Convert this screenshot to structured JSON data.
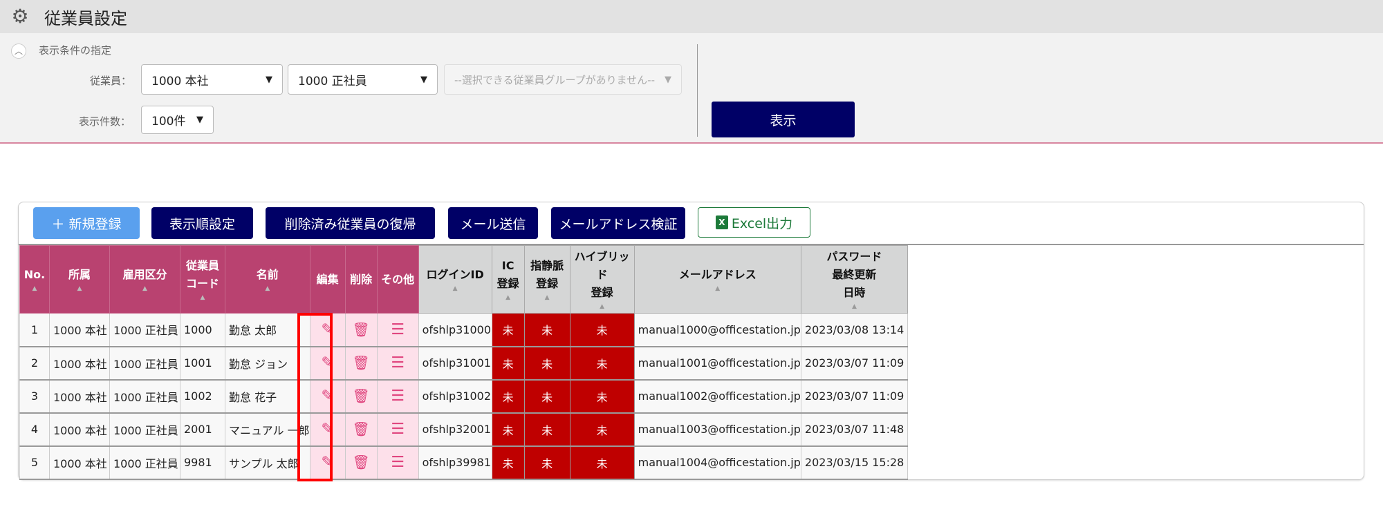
{
  "header": {
    "title": "従業員設定",
    "icon": "gear-icon"
  },
  "filter": {
    "section_label": "表示条件の指定",
    "employee_label": "従業員：",
    "office_select": "1000 本社",
    "employment_select": "1000 正社員",
    "group_select": "--選択できる従業員グループがありません--",
    "count_label": "表示件数：",
    "count_select": "100件",
    "show_button": "表示"
  },
  "toolbar": {
    "new": "＋ 新規登録",
    "order": "表示順設定",
    "restore": "削除済み従業員の復帰",
    "mail": "メール送信",
    "verify": "メールアドレス検証",
    "excel": "Excel出力"
  },
  "table": {
    "columns": [
      {
        "label": "No.",
        "style": "p",
        "sort": true
      },
      {
        "label": "所属",
        "style": "p",
        "sort": true
      },
      {
        "label": "雇用区分",
        "style": "p",
        "sort": true
      },
      {
        "label": "従業員\nコード",
        "style": "p",
        "sort": true
      },
      {
        "label": "名前",
        "style": "p",
        "sort": true
      },
      {
        "label": "編集",
        "style": "p",
        "sort": false
      },
      {
        "label": "削除",
        "style": "p",
        "sort": false
      },
      {
        "label": "その他",
        "style": "p",
        "sort": false
      },
      {
        "label": "ログインID",
        "style": "g",
        "sort": true
      },
      {
        "label": "IC\n登録",
        "style": "g",
        "sort": true
      },
      {
        "label": "指静脈\n登録",
        "style": "g",
        "sort": true
      },
      {
        "label": "ハイブリッド\n登録",
        "style": "g",
        "sort": true
      },
      {
        "label": "メールアドレス",
        "style": "g",
        "sort": true
      },
      {
        "label": "パスワード\n最終更新\n日時",
        "style": "g",
        "sort": true
      }
    ],
    "rows": [
      {
        "no": "1",
        "office": "1000 本社",
        "type": "1000 正社員",
        "code": "1000",
        "name": "勤怠 太郎",
        "login": "ofshlp31000",
        "ic": "未",
        "vein": "未",
        "hybrid": "未",
        "email": "manual1000@officestation.jp",
        "pw": "2023/03/08 13:14"
      },
      {
        "no": "2",
        "office": "1000 本社",
        "type": "1000 正社員",
        "code": "1001",
        "name": "勤怠 ジョン",
        "login": "ofshlp31001",
        "ic": "未",
        "vein": "未",
        "hybrid": "未",
        "email": "manual1001@officestation.jp",
        "pw": "2023/03/07 11:09"
      },
      {
        "no": "3",
        "office": "1000 本社",
        "type": "1000 正社員",
        "code": "1002",
        "name": "勤怠 花子",
        "login": "ofshlp31002",
        "ic": "未",
        "vein": "未",
        "hybrid": "未",
        "email": "manual1002@officestation.jp",
        "pw": "2023/03/07 11:09"
      },
      {
        "no": "4",
        "office": "1000 本社",
        "type": "1000 正社員",
        "code": "2001",
        "name": "マニュアル 一郎",
        "login": "ofshlp32001",
        "ic": "未",
        "vein": "未",
        "hybrid": "未",
        "email": "manual1003@officestation.jp",
        "pw": "2023/03/07 11:48"
      },
      {
        "no": "5",
        "office": "1000 本社",
        "type": "1000 正社員",
        "code": "9981",
        "name": "サンプル 太郎",
        "login": "ofshlp39981",
        "ic": "未",
        "vein": "未",
        "hybrid": "未",
        "email": "manual1004@officestation.jp",
        "pw": "2023/03/15 15:28"
      }
    ]
  },
  "colors": {
    "accent": "#b94270",
    "navy": "#000066",
    "unregistered": "#bf0000",
    "highlight": "#ff0000"
  }
}
